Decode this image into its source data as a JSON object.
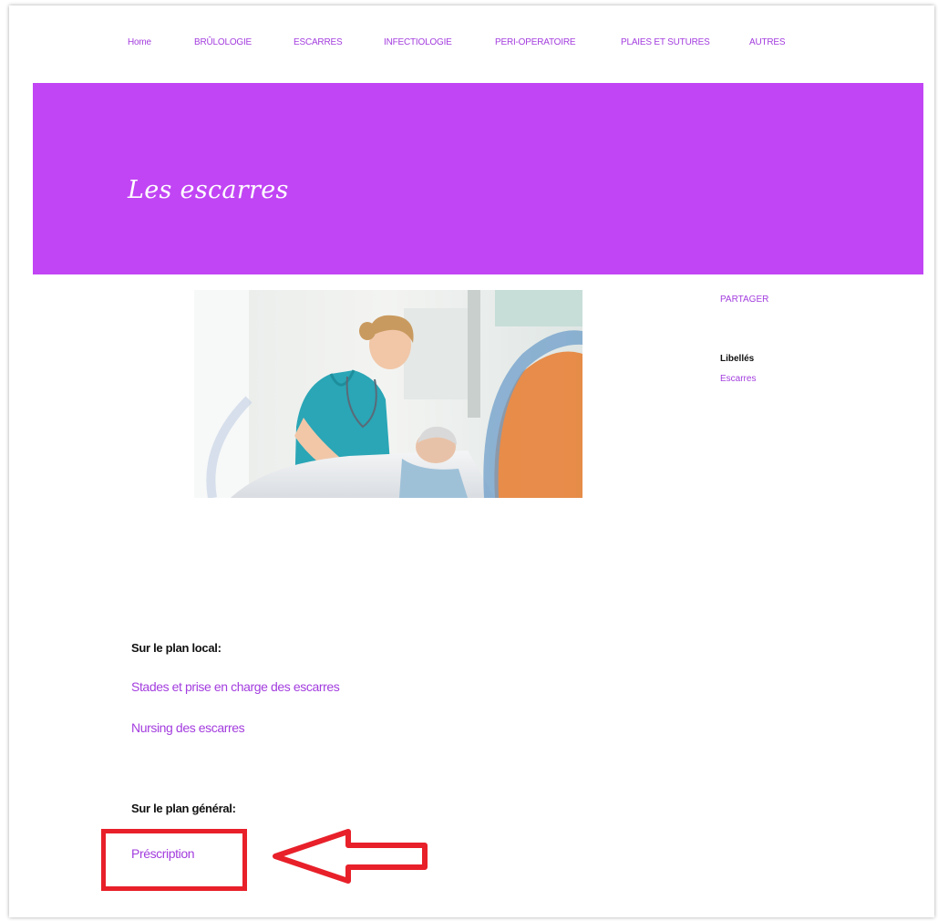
{
  "nav": {
    "items": [
      "Home",
      "BRÛLOLOGIE",
      "ESCARRES",
      "INFECTIOLOGIE",
      "PERI-OPERATOIRE",
      "PLAIES ET SUTURES",
      "AUTRES"
    ]
  },
  "banner": {
    "title": "Les escarres",
    "color": "#c145f4"
  },
  "hero": {
    "icon": "nurse-patient-photo"
  },
  "sidebar": {
    "share_label": "PARTAGER",
    "labels_heading": "Libellés",
    "tag": "Escarres"
  },
  "local": {
    "heading": "Sur le plan local:",
    "links": [
      "Stades et prise en charge des escarres",
      "Nursing des escarres"
    ]
  },
  "general": {
    "heading": "Sur le plan général:",
    "links": [
      "Préscription"
    ]
  },
  "colors": {
    "link": "#a33dde",
    "callout": "#e8202a"
  }
}
